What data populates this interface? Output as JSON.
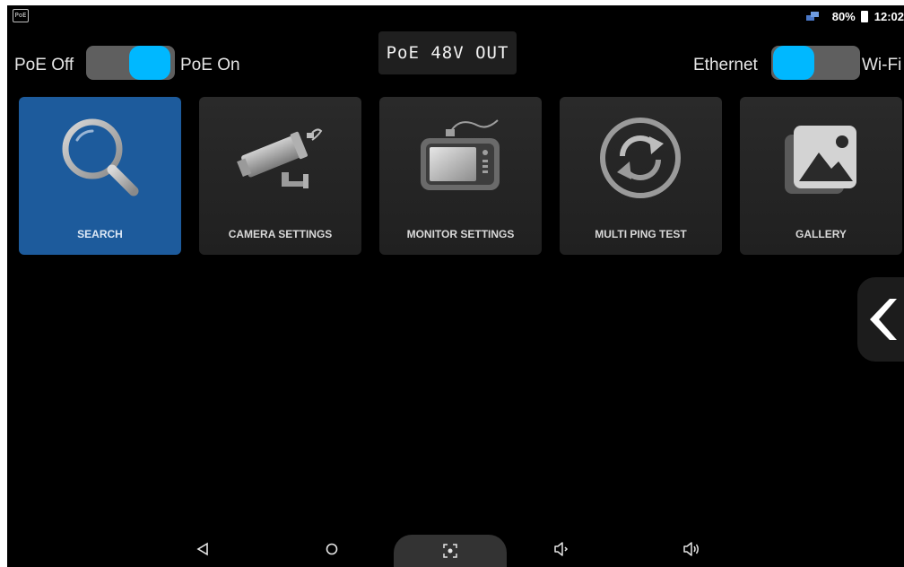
{
  "status_bar": {
    "app_badge": "PoE",
    "battery_percent": "80%",
    "time": "12:02"
  },
  "poe_switch": {
    "off_label": "PoE Off",
    "on_label": "PoE On",
    "state": "on"
  },
  "poe_readout": {
    "text": "PoE 48V OUT"
  },
  "network_switch": {
    "left_label": "Ethernet",
    "right_label": "Wi-Fi",
    "state": "ethernet"
  },
  "tiles": [
    {
      "label": "SEARCH",
      "icon": "magnifier-icon",
      "active": true
    },
    {
      "label": "CAMERA SETTINGS",
      "icon": "cctv-camera-icon",
      "active": false
    },
    {
      "label": "MONITOR SETTINGS",
      "icon": "tester-device-icon",
      "active": false
    },
    {
      "label": "MULTI PING TEST",
      "icon": "refresh-cycle-icon",
      "active": false
    },
    {
      "label": "GALLERY",
      "icon": "photo-gallery-icon",
      "active": false
    }
  ],
  "colors": {
    "accent": "#00b8ff",
    "active_tile": "#1d5b9c",
    "background": "#000000"
  },
  "nav_bar": {
    "buttons": [
      "back-icon",
      "home-icon",
      "screenshot-icon",
      "volume-down-icon",
      "volume-up-icon"
    ]
  }
}
